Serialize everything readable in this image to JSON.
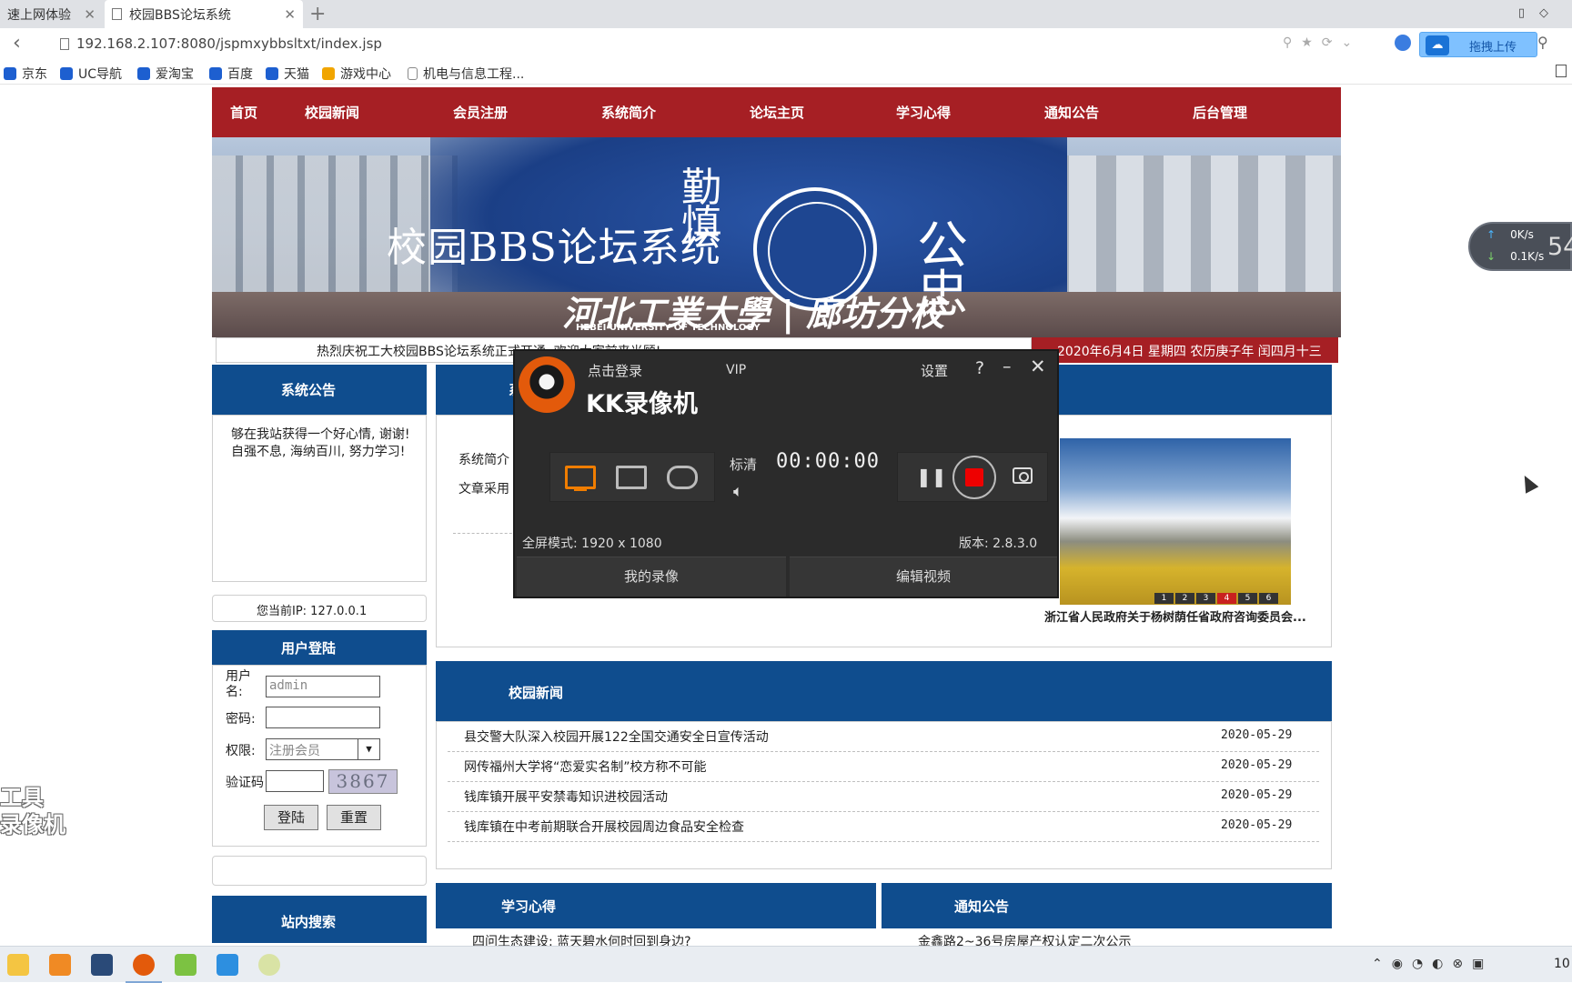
{
  "browser": {
    "tabs": [
      {
        "label": "速上网体验"
      },
      {
        "label": "校园BBS论坛系统"
      }
    ],
    "url": "192.168.2.107:8080/jspmxybbsltxt/index.jsp",
    "upload_label": "拖拽上传",
    "bookmarks": [
      "京东",
      "UC导航",
      "爱淘宝",
      "百度",
      "天猫",
      "游戏中心",
      "机电与信息工程..."
    ]
  },
  "nav": [
    "首页",
    "校园新闻",
    "会员注册",
    "系统简介",
    "论坛主页",
    "学习心得",
    "通知公告",
    "后台管理"
  ],
  "banner": {
    "title": "校园BBS论坛系统",
    "motto": [
      "勤",
      "慎",
      "公",
      "忠"
    ],
    "university_cn": "河北工業大學 | 廊坊分校",
    "university_en": "HEBEI UNIVERSITY OF TECHNOLOGY"
  },
  "ticker": "热烈庆祝工大校园BBS论坛系统正式开通, 欢迎大家前来光顾!",
  "date_text": "2020年6月4日 星期四 农历庚子年 闰四月十三",
  "sidebar": {
    "notice_title": "系统公告",
    "notice_text": "够在我站获得一个好心情, 谢谢!        自强不息, 海纳百川, 努力学习!",
    "ip_text": "您当前IP: 127.0.0.1",
    "login_title": "用户登陆",
    "username_label": "用户名:",
    "username_value": "admin",
    "password_label": "密码:",
    "role_label": "权限:",
    "role_value": "注册会员",
    "captcha_label": "验证码",
    "captcha_value": "3867",
    "login_button": "登陆",
    "reset_button": "重置",
    "search_title": "站内搜索"
  },
  "intro": {
    "head_fragment": "系",
    "line1": "系统简介",
    "line2": "文章采用",
    "slide_numbers": [
      "1",
      "2",
      "3",
      "4",
      "5",
      "6"
    ],
    "slide_active": "4",
    "slide_caption": "浙江省人民政府关于杨树荫任省政府咨询委员会..."
  },
  "news": {
    "title": "校园新闻",
    "items": [
      {
        "title": "县交警大队深入校园开展122全国交通安全日宣传活动",
        "date": "2020-05-29"
      },
      {
        "title": "网传福州大学将“恋爱实名制”校方称不可能",
        "date": "2020-05-29"
      },
      {
        "title": "钱库镇开展平安禁毒知识进校园活动",
        "date": "2020-05-29"
      },
      {
        "title": "钱库镇在中考前期联合开展校园周边食品安全检查",
        "date": "2020-05-29"
      }
    ]
  },
  "study": {
    "title": "学习心得",
    "first_item": "四问生态建设: 蓝天碧水何时回到身边?"
  },
  "bulletin": {
    "title": "通知公告",
    "first_item": "金鑫路2~36号房屋产权认定二次公示"
  },
  "kk": {
    "login": "点击登录",
    "vip": "VIP",
    "title": "KK录像机",
    "settings": "设置",
    "help": "?",
    "minimize": "–",
    "close": "✕",
    "quality": "标清",
    "timer": "00:00:00",
    "mode_text": "全屏模式: 1920 x 1080",
    "version": "版本: 2.8.3.0",
    "my_recordings": "我的录像",
    "edit_video": "编辑视频"
  },
  "speed": {
    "up": "0K/s",
    "down": "0.1K/s",
    "number": "54"
  },
  "watermark": [
    "工具",
    "录像机"
  ],
  "clock": "10"
}
